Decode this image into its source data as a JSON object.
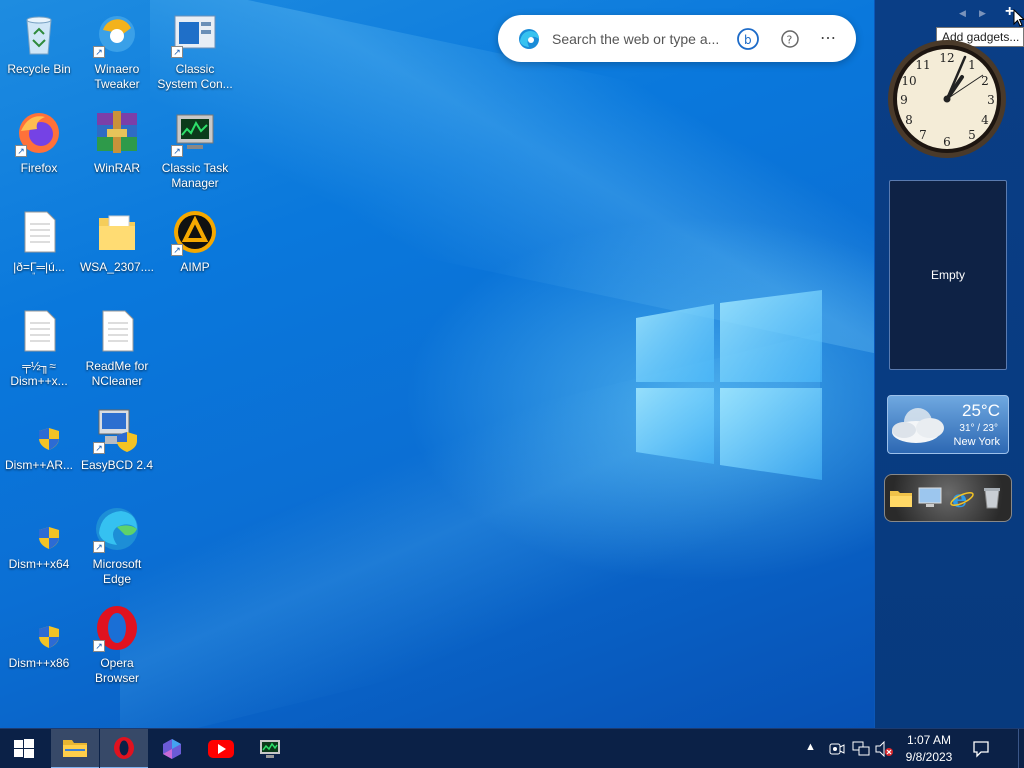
{
  "desktop": {
    "icons": [
      {
        "label": "Recycle Bin",
        "icon": "recycle-bin-icon"
      },
      {
        "label": "Winaero Tweaker",
        "icon": "winaero-tweaker-icon"
      },
      {
        "label": "Classic System Con...",
        "icon": "control-panel-icon"
      },
      {
        "label": "Firefox",
        "icon": "firefox-icon"
      },
      {
        "label": "WinRAR",
        "icon": "winrar-icon"
      },
      {
        "label": "Classic Task Manager",
        "icon": "task-manager-icon"
      },
      {
        "label": "|ð=ܸΓ═|ú...",
        "icon": "text-file-icon"
      },
      {
        "label": "WSA_2307....",
        "icon": "folder-icon"
      },
      {
        "label": "AIMP",
        "icon": "aimp-icon"
      },
      {
        "label": "╤½╖≈ Dism++x...",
        "icon": "text-file-icon"
      },
      {
        "label": "ReadMe for NCleaner",
        "icon": "text-file-icon"
      },
      {
        "label": "Dism++AR...",
        "icon": "uac-shield-icon"
      },
      {
        "label": "EasyBCD 2.4",
        "icon": "easybcd-icon"
      },
      {
        "label": "Dism++x64",
        "icon": "uac-shield-icon"
      },
      {
        "label": "Microsoft Edge",
        "icon": "edge-icon"
      },
      {
        "label": "Dism++x86",
        "icon": "uac-shield-icon"
      },
      {
        "label": "Opera Browser",
        "icon": "opera-icon"
      }
    ]
  },
  "searchbar": {
    "placeholder": "Search the web or type a...",
    "icons": [
      "edge-logo-icon",
      "bing-icon",
      "help-icon",
      "more-icon"
    ]
  },
  "sidebar": {
    "tooltip": "Add gadgets...",
    "empty_label": "Empty",
    "clock": {
      "hour": 1,
      "minute": 7
    },
    "weather": {
      "temp": "25°C",
      "range": "31° / 23°",
      "city": "New York"
    }
  },
  "taskbar": {
    "items": [
      "start-icon",
      "file-explorer-icon",
      "opera-icon",
      "copilot-icon",
      "youtube-icon",
      "task-manager-icon"
    ],
    "tray_icons": [
      "chevron-up-icon",
      "meet-now-icon",
      "network-icon",
      "volume-muted-icon"
    ],
    "time": "1:07 AM",
    "date": "9/8/2023"
  },
  "colors": {
    "taskbar": "#0b2147",
    "sidebar": "#0a3e86",
    "accent": "#0078d7"
  }
}
